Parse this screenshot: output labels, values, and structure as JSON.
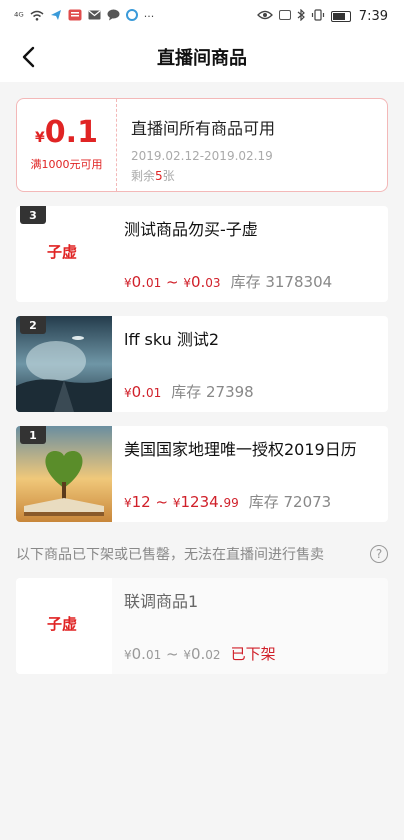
{
  "status_bar": {
    "signal": "⁴ᴳ",
    "time": "7:39"
  },
  "header": {
    "title": "直播间商品"
  },
  "coupon": {
    "currency": "¥",
    "value": "0.1",
    "condition": "满1000元可用",
    "scope": "直播间所有商品可用",
    "date_range": "2019.02.12-2019.02.19",
    "remain_prefix": "剩余",
    "remain_count": "5",
    "remain_suffix": "张"
  },
  "products": [
    {
      "rank": "3",
      "name": "测试商品勿买-子虚",
      "price_low": "0.",
      "price_low_dec": "01",
      "sep": " ~ ",
      "price_high": "0.",
      "price_high_dec": "03",
      "currency": "¥",
      "stock": "库存 3178304",
      "logo": "子虚"
    },
    {
      "rank": "2",
      "name": "lff sku 测试2",
      "currency": "¥",
      "price_single": "0.",
      "price_single_dec": "01",
      "stock": "库存 27398"
    },
    {
      "rank": "1",
      "name": "美国国家地理唯一授权2019日历",
      "currency": "¥",
      "price_low": "12",
      "sep": " ~ ",
      "price_high": "1234.",
      "price_high_dec": "99",
      "stock": "库存 72073"
    }
  ],
  "offline_notice": "以下商品已下架或已售罄，无法在直播间进行售卖",
  "help_icon": "?",
  "offline_products": [
    {
      "name": "联调商品1",
      "currency": "¥",
      "price_low": "0.",
      "price_low_dec": "01",
      "sep": " ~ ",
      "price_high": "0.",
      "price_high_dec": "02",
      "status": "已下架",
      "logo": "子虚"
    }
  ],
  "colors": {
    "accent": "#e02424",
    "price": "#d0202a"
  }
}
